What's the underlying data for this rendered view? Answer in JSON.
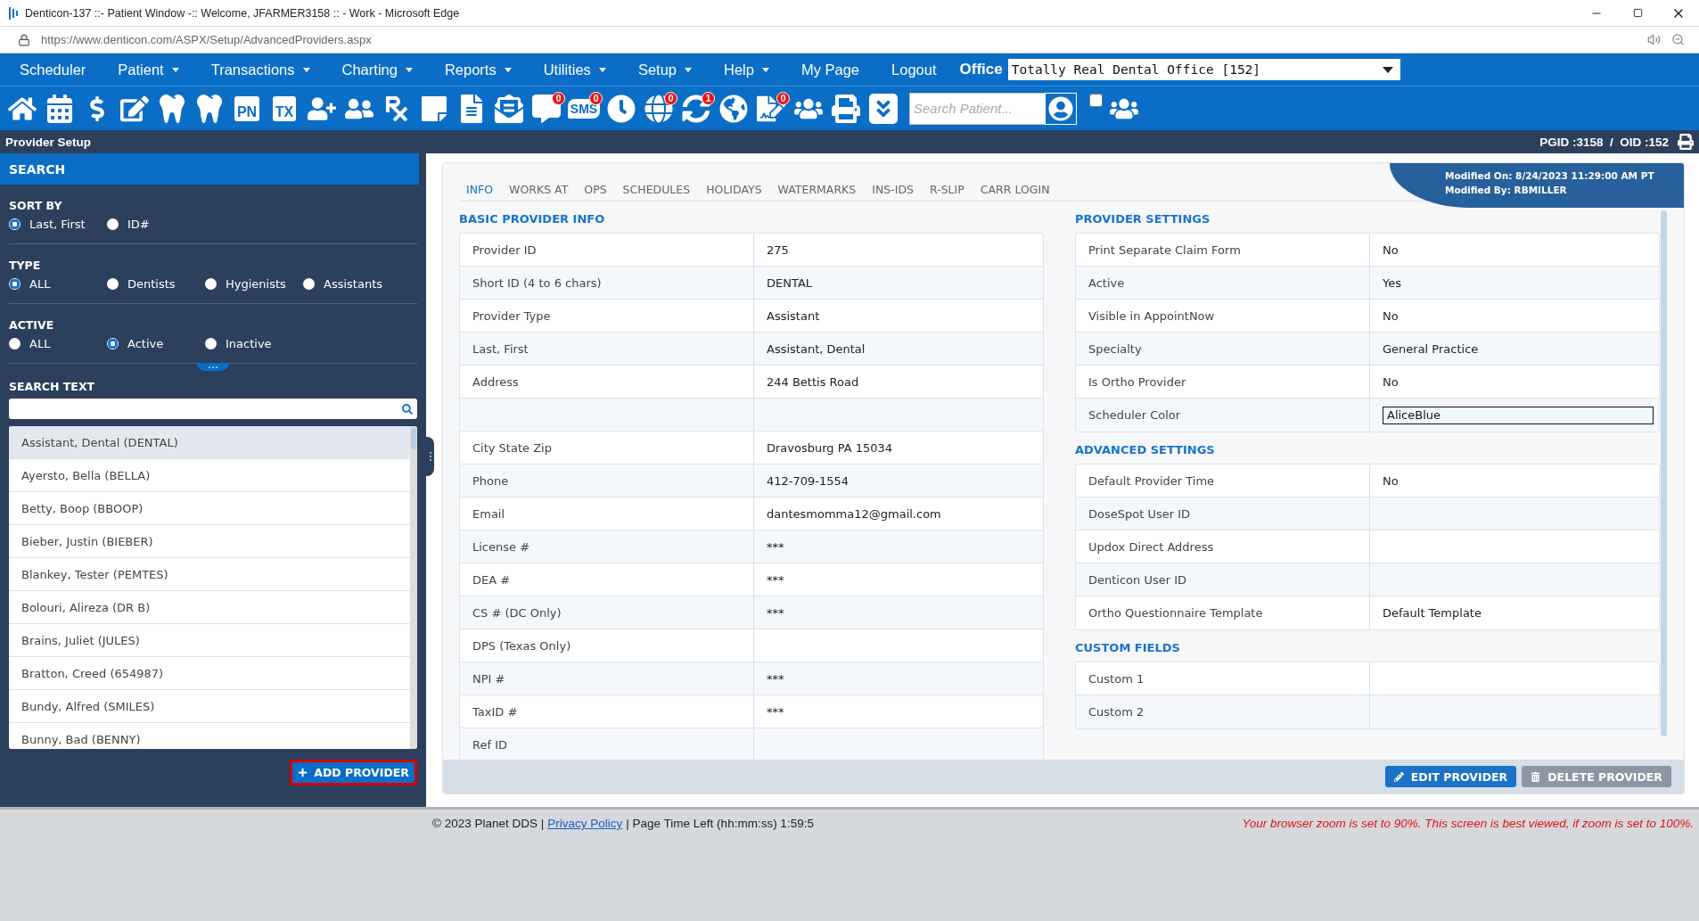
{
  "window": {
    "title": "Denticon-137 ::- Patient Window -:: Welcome, JFARMER3158 :: - Work - Microsoft Edge"
  },
  "address_bar": {
    "url": "https://www.denticon.com/ASPX/Setup/AdvancedProviders.aspx"
  },
  "menu": [
    {
      "label": "Scheduler",
      "dropdown": false
    },
    {
      "label": "Patient",
      "dropdown": true
    },
    {
      "label": "Transactions",
      "dropdown": true
    },
    {
      "label": "Charting",
      "dropdown": true
    },
    {
      "label": "Reports",
      "dropdown": true
    },
    {
      "label": "Utilities",
      "dropdown": true
    },
    {
      "label": "Setup",
      "dropdown": true
    },
    {
      "label": "Help",
      "dropdown": true
    },
    {
      "label": "My Page",
      "dropdown": false
    },
    {
      "label": "Logout",
      "dropdown": false
    }
  ],
  "office": {
    "label": "Office",
    "value": "Totally Real Dental Office [152]"
  },
  "toolbar": {
    "items": [
      {
        "kind": "glyph"
      },
      {
        "kind": "glyph"
      },
      {
        "kind": "glyph"
      },
      {
        "kind": "glyph"
      },
      {
        "kind": "glyph"
      },
      {
        "kind": "glyph"
      },
      {
        "kind": "text",
        "label": "PN"
      },
      {
        "kind": "text",
        "label": "TX"
      },
      {
        "kind": "glyph"
      },
      {
        "kind": "glyph"
      },
      {
        "kind": "glyph"
      },
      {
        "kind": "glyph"
      },
      {
        "kind": "glyph"
      },
      {
        "kind": "glyph"
      },
      {
        "kind": "glyph",
        "badge": "0"
      },
      {
        "kind": "bubble",
        "label": "SMS",
        "badge": "0"
      },
      {
        "kind": "glyph"
      },
      {
        "kind": "glyph",
        "badge": "0"
      },
      {
        "kind": "glyph",
        "badge": "1"
      },
      {
        "kind": "glyph"
      },
      {
        "kind": "glyph",
        "badge": "0"
      },
      {
        "kind": "glyph"
      },
      {
        "kind": "glyph"
      },
      {
        "kind": "glyph"
      }
    ],
    "search": {
      "placeholder": "Search Patient..."
    },
    "checkbox": {
      "checked": false
    }
  },
  "page_header": {
    "title": "Provider Setup",
    "ids": "PGID :3158  /  OID :152"
  },
  "search_panel": {
    "title": "SEARCH",
    "groups": [
      {
        "label": "SORT BY",
        "options": [
          {
            "label": "Last, First",
            "selected": true
          },
          {
            "label": "ID#",
            "selected": false
          }
        ]
      },
      {
        "label": "TYPE",
        "options": [
          {
            "label": "ALL",
            "selected": true
          },
          {
            "label": "Dentists",
            "selected": false
          },
          {
            "label": "Hygienists",
            "selected": false
          },
          {
            "label": "Assistants",
            "selected": false
          }
        ]
      },
      {
        "label": "ACTIVE",
        "options": [
          {
            "label": "ALL",
            "selected": false
          },
          {
            "label": "Active",
            "selected": true
          },
          {
            "label": "Inactive",
            "selected": false
          }
        ]
      }
    ],
    "search_text": {
      "label": "SEARCH TEXT"
    },
    "providers": [
      {
        "name": "Assistant, Dental (DENTAL)",
        "selected": true
      },
      {
        "name": "Ayersto, Bella (BELLA)",
        "selected": false
      },
      {
        "name": "Betty, Boop (BBOOP)",
        "selected": false
      },
      {
        "name": "Bieber, Justin (BIEBER)",
        "selected": false
      },
      {
        "name": "Blankey, Tester (PEMTES)",
        "selected": false
      },
      {
        "name": "Bolouri, Alireza (DR B)",
        "selected": false
      },
      {
        "name": "Brains, Juliet (JULES)",
        "selected": false
      },
      {
        "name": "Bratton, Creed (654987)",
        "selected": false
      },
      {
        "name": "Bundy, Alfred (SMILES)",
        "selected": false
      },
      {
        "name": "Bunny, Bad (BENNY)",
        "selected": false
      }
    ],
    "add_button": {
      "label": "ADD PROVIDER",
      "focused": true
    }
  },
  "tabs": [
    {
      "label": "INFO",
      "selected": true
    },
    {
      "label": "WORKS AT",
      "selected": false
    },
    {
      "label": "OPS",
      "selected": false
    },
    {
      "label": "SCHEDULES",
      "selected": false
    },
    {
      "label": "HOLIDAYS",
      "selected": false
    },
    {
      "label": "WATERMARKS",
      "selected": false
    },
    {
      "label": "INS-IDS",
      "selected": false
    },
    {
      "label": "R-SLIP",
      "selected": false
    },
    {
      "label": "CARR LOGIN",
      "selected": false
    }
  ],
  "modified": {
    "on": "Modified On: 8/24/2023 11:29:00 AM PT",
    "by": "Modified By: RBMILLER"
  },
  "columns": [
    [
      {
        "title": "BASIC PROVIDER INFO",
        "rows": [
          {
            "kind": "text",
            "label": "Provider ID",
            "value": "275"
          },
          {
            "kind": "text",
            "label": "Short ID (4 to 6 chars)",
            "value": "DENTAL"
          },
          {
            "kind": "text",
            "label": "Provider Type",
            "value": "Assistant"
          },
          {
            "kind": "text",
            "label": "Last, First",
            "value": "Assistant, Dental"
          },
          {
            "kind": "text",
            "label": "Address",
            "value": "244 Bettis Road"
          },
          {
            "kind": "text"
          },
          {
            "kind": "text",
            "label": "City State Zip",
            "value": "Dravosburg PA 15034"
          },
          {
            "kind": "text",
            "label": "Phone",
            "value": "412-709-1554"
          },
          {
            "kind": "text",
            "label": "Email",
            "value": "dantesmomma12@gmail.com"
          },
          {
            "kind": "text",
            "label": "License #",
            "value": "***"
          },
          {
            "kind": "text",
            "label": "DEA #",
            "value": "***"
          },
          {
            "kind": "text",
            "label": "CS # (DC Only)",
            "value": "***"
          },
          {
            "kind": "text",
            "label": "DPS (Texas Only)"
          },
          {
            "kind": "text",
            "label": "NPI #",
            "value": "***"
          },
          {
            "kind": "text",
            "label": "TaxID #",
            "value": "***"
          },
          {
            "kind": "text",
            "label": "Ref ID"
          }
        ]
      }
    ],
    [
      {
        "title": "PROVIDER SETTINGS",
        "rows": [
          {
            "kind": "text",
            "label": "Print Separate Claim Form",
            "value": "No"
          },
          {
            "kind": "text",
            "label": "Active",
            "value": "Yes"
          },
          {
            "kind": "text",
            "label": "Visible in AppointNow",
            "value": "No"
          },
          {
            "kind": "text",
            "label": "Specialty",
            "value": "General Practice"
          },
          {
            "kind": "text",
            "label": "Is Ortho Provider",
            "value": "No"
          },
          {
            "kind": "field",
            "label": "Scheduler Color",
            "value": "AliceBlue"
          }
        ]
      },
      {
        "title": "ADVANCED SETTINGS",
        "rows": [
          {
            "kind": "text",
            "label": "Default Provider Time",
            "value": "No"
          },
          {
            "kind": "text",
            "label": "DoseSpot User ID"
          },
          {
            "kind": "text",
            "label": "Updox Direct Address"
          },
          {
            "kind": "text",
            "label": "Denticon User ID"
          },
          {
            "kind": "text",
            "label": "Ortho Questionnaire Template",
            "value": "Default Template"
          }
        ]
      },
      {
        "title": "CUSTOM FIELDS",
        "rows": [
          {
            "kind": "text",
            "label": "Custom 1"
          },
          {
            "kind": "text",
            "label": "Custom 2"
          }
        ]
      }
    ]
  ],
  "footer_buttons": [
    {
      "kind": "edit",
      "label": "EDIT PROVIDER",
      "disabled": false
    },
    {
      "kind": "delete",
      "label": "DELETE PROVIDER",
      "disabled": true
    }
  ],
  "status_bar": {
    "copyright": "© 2023 Planet DDS |",
    "link": "Privacy Policy",
    "time_left": "| Page Time Left (hh:mm:ss) 1:59:5",
    "warning": "Your browser zoom is set to 90%. This screen is best viewed, if zoom is set to 100%."
  }
}
